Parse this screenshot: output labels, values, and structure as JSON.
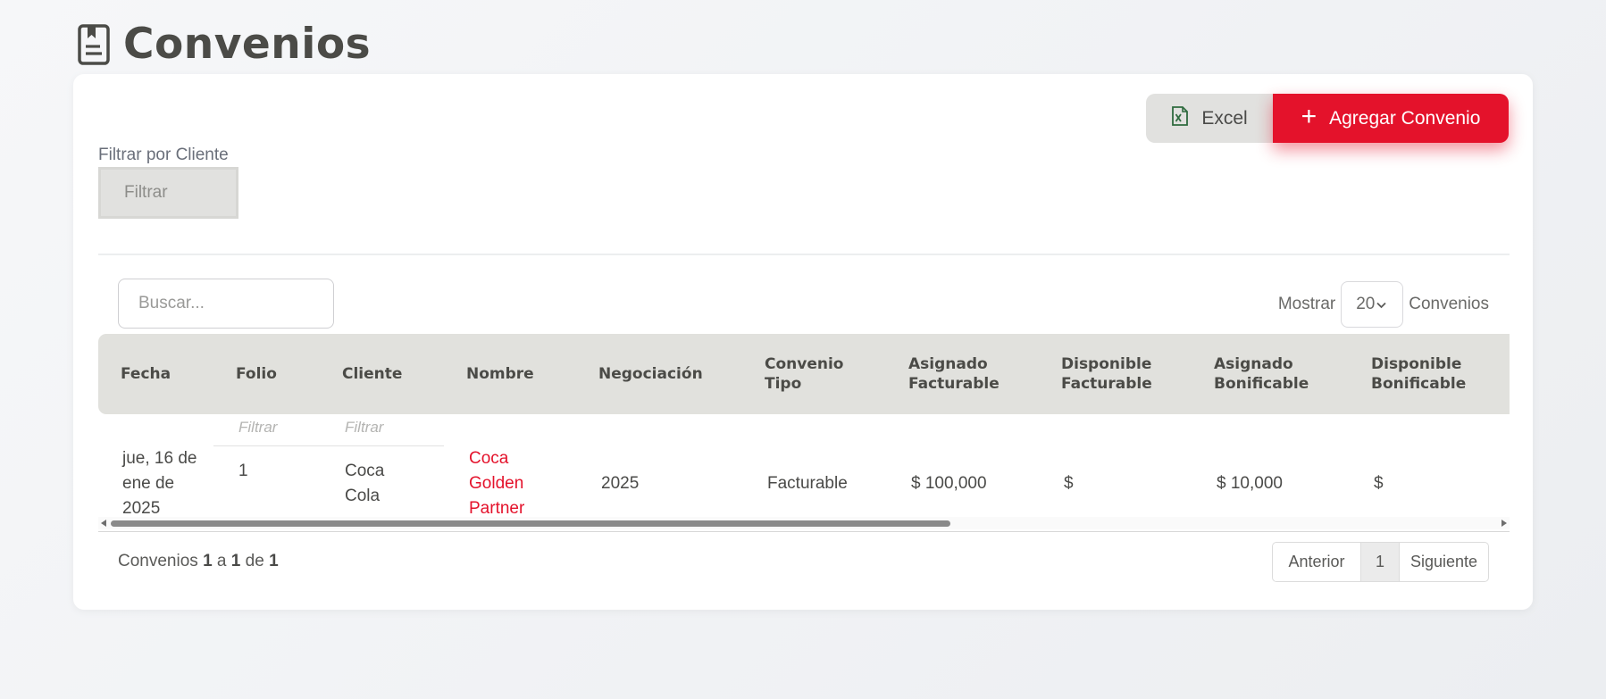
{
  "header": {
    "title": "Convenios",
    "icon": "document-icon"
  },
  "toolbar": {
    "excel_label": "Excel",
    "add_label": "Agregar Convenio",
    "add_color": "#e4122b"
  },
  "filter": {
    "label": "Filtrar por Cliente",
    "placeholder": "Filtrar"
  },
  "table": {
    "search_placeholder": "Buscar...",
    "show_label": "Mostrar",
    "page_size": "20",
    "show_suffix": "Convenios",
    "columns": [
      "Fecha",
      "Folio",
      "Cliente",
      "Nombre",
      "Negociación",
      "Convenio Tipo",
      "Asignado Facturable",
      "Disponible Facturable",
      "Asignado Bonificable",
      "Disponible Bonificable"
    ],
    "column_filters": {
      "folio": "Filtrar",
      "cliente": "Filtrar"
    },
    "rows": [
      {
        "fecha": "jue, 16 de ene de 2025",
        "folio": "1",
        "cliente": "Coca Cola",
        "nombre": "Coca Golden Partner",
        "negociacion": "2025",
        "tipo": "Facturable",
        "asignado_facturable": "$ 100,000",
        "disponible_facturable": "$",
        "asignado_bonificable": "$ 10,000",
        "disponible_bonificable": "$"
      }
    ]
  },
  "footer": {
    "info_prefix": "Convenios",
    "from": "1",
    "a": "a",
    "to": "1",
    "de": "de",
    "total": "1",
    "prev": "Anterior",
    "current_page": "1",
    "next": "Siguiente"
  }
}
